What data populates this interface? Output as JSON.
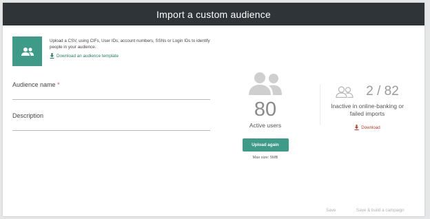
{
  "header": {
    "title": "Import a custom audience"
  },
  "upload_info": {
    "description": "Upload a CSV, using CIFs, User IDs, account numbers, SSNs or Login IDs to identify people in your audience.",
    "template_link": "Download an audience template"
  },
  "form": {
    "audience_name": {
      "label": "Audience name",
      "required_mark": "*",
      "value": ""
    },
    "description": {
      "label": "Description",
      "value": ""
    }
  },
  "active": {
    "count": "80",
    "label": "Active users",
    "upload_button": "Upload again",
    "max_size": "Max size: 5MB"
  },
  "inactive": {
    "ratio": "2 / 82",
    "label": "Inactive in online-banking or failed imports",
    "download_link": "Download"
  },
  "footer": {
    "save": "Save",
    "save_build": "Save & build a campaign"
  },
  "colors": {
    "header_bg": "#2f3439",
    "accent": "#3d9b87",
    "link": "#237a68",
    "required": "#d9534f",
    "download": "#c0392b"
  },
  "icons": {
    "tile": "users-icon",
    "template": "download-icon",
    "active": "users-icon",
    "inactive": "users-outline-icon",
    "download": "download-icon"
  }
}
